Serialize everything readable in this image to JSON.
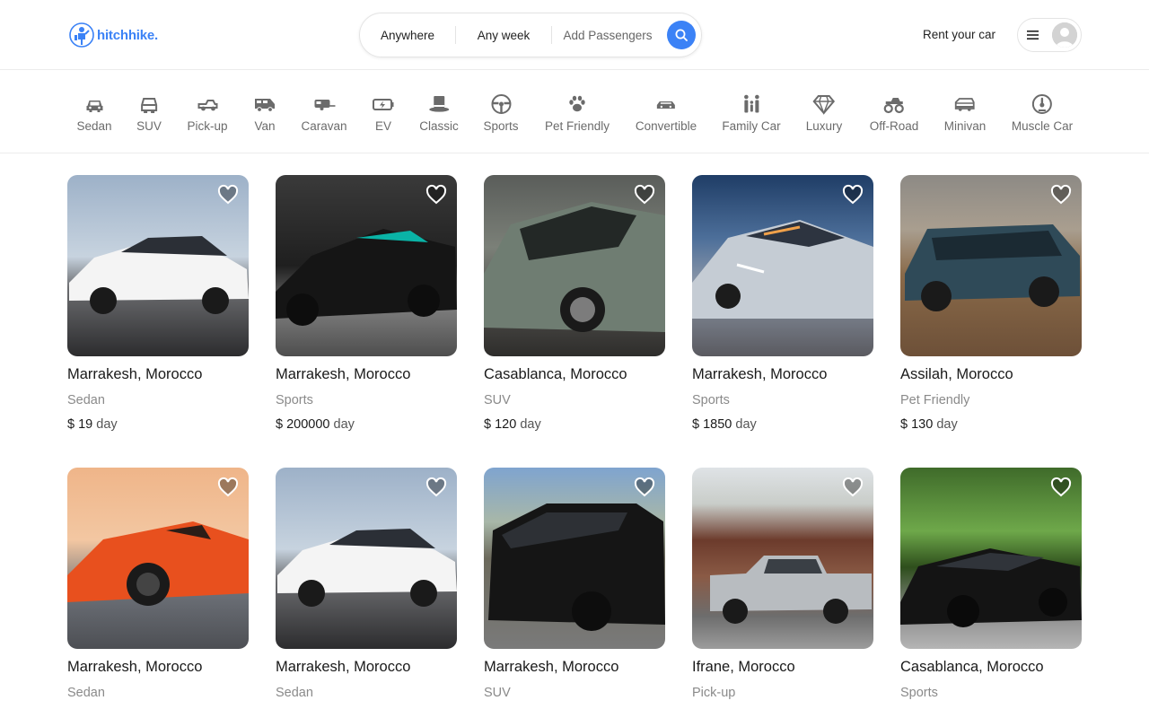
{
  "brand": {
    "name": "hitchhike."
  },
  "search": {
    "where": "Anywhere",
    "when": "Any week",
    "who": "Add Passengers"
  },
  "header": {
    "rent_label": "Rent your car"
  },
  "categories": [
    {
      "label": "Sedan",
      "icon": "sedan-icon"
    },
    {
      "label": "SUV",
      "icon": "suv-icon"
    },
    {
      "label": "Pick-up",
      "icon": "pickup-icon"
    },
    {
      "label": "Van",
      "icon": "van-icon"
    },
    {
      "label": "Caravan",
      "icon": "caravan-icon"
    },
    {
      "label": "EV",
      "icon": "battery-icon"
    },
    {
      "label": "Classic",
      "icon": "top-hat-icon"
    },
    {
      "label": "Sports",
      "icon": "steering-wheel-icon"
    },
    {
      "label": "Pet Friendly",
      "icon": "paw-icon"
    },
    {
      "label": "Convertible",
      "icon": "convertible-icon"
    },
    {
      "label": "Family Car",
      "icon": "family-icon"
    },
    {
      "label": "Luxury",
      "icon": "diamond-icon"
    },
    {
      "label": "Off-Road",
      "icon": "monster-truck-icon"
    },
    {
      "label": "Minivan",
      "icon": "minivan-icon"
    },
    {
      "label": "Muscle Car",
      "icon": "gauge-icon"
    }
  ],
  "listings": [
    {
      "location": "Marrakesh, Morocco",
      "type": "Sedan",
      "price": "$ 19",
      "unit": "day",
      "color": "#f2f2f2"
    },
    {
      "location": "Marrakesh, Morocco",
      "type": "Sports",
      "price": "$ 200000",
      "unit": "day",
      "color": "#1c1c1c"
    },
    {
      "location": "Casablanca, Morocco",
      "type": "SUV",
      "price": "$ 120",
      "unit": "day",
      "color": "#6f7d72"
    },
    {
      "location": "Marrakesh, Morocco",
      "type": "Sports",
      "price": "$ 1850",
      "unit": "day",
      "color": "#b9c3cf"
    },
    {
      "location": "Assilah, Morocco",
      "type": "Pet Friendly",
      "price": "$ 130",
      "unit": "day",
      "color": "#2f4a58"
    },
    {
      "location": "Marrakesh, Morocco",
      "type": "Sedan",
      "price": "",
      "unit": "",
      "color": "#e8501e"
    },
    {
      "location": "Marrakesh, Morocco",
      "type": "Sedan",
      "price": "",
      "unit": "",
      "color": "#f4f4f4"
    },
    {
      "location": "Marrakesh, Morocco",
      "type": "SUV",
      "price": "",
      "unit": "",
      "color": "#151515"
    },
    {
      "location": "Ifrane, Morocco",
      "type": "Pick-up",
      "price": "",
      "unit": "",
      "color": "#b8bcc0"
    },
    {
      "location": "Casablanca, Morocco",
      "type": "Sports",
      "price": "",
      "unit": "",
      "color": "#141414"
    }
  ],
  "theme": {
    "accent": "#3b82f6"
  }
}
